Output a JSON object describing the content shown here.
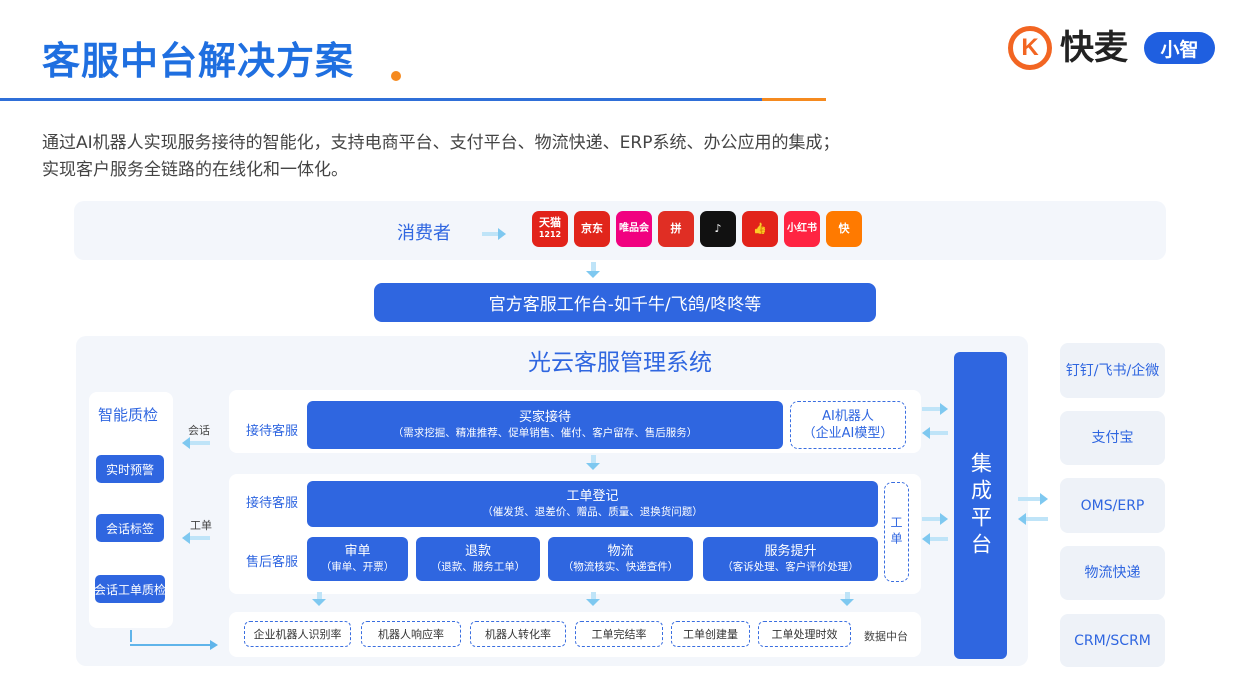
{
  "header": {
    "title": "客服中台解决方案",
    "logo_k": "K",
    "logo_text": "快麦",
    "logo_badge": "小智"
  },
  "description": {
    "line1": "通过AI机器人实现服务接待的智能化，支持电商平台、支付平台、物流快递、ERP系统、办公应用的集成；",
    "line2": "实现客户服务全链路的在线化和一体化。"
  },
  "consumer": {
    "label": "消费者",
    "apps": [
      {
        "name": "tmall-icon",
        "text": "天猫",
        "sub": "1212",
        "color": "#e2231a"
      },
      {
        "name": "jd-icon",
        "text": "京东",
        "sub": "",
        "color": "#e1251b"
      },
      {
        "name": "vipshop-icon",
        "text": "唯品会",
        "sub": "",
        "color": "#f10180"
      },
      {
        "name": "pinduoduo-icon",
        "text": "拼",
        "sub": "",
        "color": "#e02e24"
      },
      {
        "name": "douyin-icon",
        "text": "♪",
        "sub": "",
        "color": "#111111"
      },
      {
        "name": "kuaishou-like-icon",
        "text": "👍",
        "sub": "",
        "color": "#e2231a"
      },
      {
        "name": "xiaohongshu-icon",
        "text": "小红书",
        "sub": "",
        "color": "#ff2442"
      },
      {
        "name": "kuaishou-icon",
        "text": "快",
        "sub": "",
        "color": "#ff7a00"
      }
    ]
  },
  "workbench": {
    "label": "官方客服工作台-如千牛/飞鸽/咚咚等"
  },
  "system": {
    "title": "光云客服管理系统",
    "quality": {
      "title": "智能质检",
      "items": [
        "实时预警",
        "会话标签",
        "会话工单质检"
      ],
      "session_label": "会话",
      "ticket_label": "工单"
    },
    "row1": {
      "label": "接待客服",
      "main": "买家接待",
      "sub": "（需求挖掘、精准推荐、促单销售、催付、客户留存、售后服务）",
      "ai_main": "AI机器人",
      "ai_sub": "（企业AI模型）"
    },
    "row2": {
      "label": "接待客服",
      "main": "工单登记",
      "sub": "（催发货、退差价、赠品、质量、退换货问题）",
      "side": "工单"
    },
    "row3": {
      "label": "售后客服",
      "boxes": [
        {
          "main": "审单",
          "sub": "（审单、开票）"
        },
        {
          "main": "退款",
          "sub": "（退款、服务工单）"
        },
        {
          "main": "物流",
          "sub": "（物流核实、快递查件）"
        },
        {
          "main": "服务提升",
          "sub": "（客诉处理、客户评价处理）"
        }
      ]
    },
    "metrics": {
      "items": [
        "企业机器人识别率",
        "机器人响应率",
        "机器人转化率",
        "工单完结率",
        "工单创建量",
        "工单处理时效"
      ],
      "label": "数据中台"
    }
  },
  "integration": {
    "label": "集成平台"
  },
  "external": [
    "钉钉/飞书/企微",
    "支付宝",
    "OMS/ERP",
    "物流快递",
    "CRM/SCRM"
  ]
}
